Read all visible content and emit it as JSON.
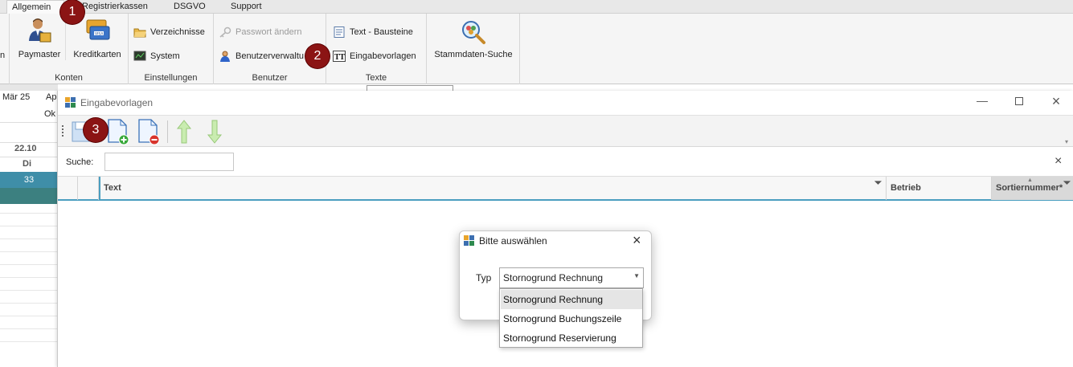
{
  "ribbon": {
    "tabs": [
      "Allgemein",
      "Registrierkassen",
      "DSGVO",
      "Support"
    ],
    "groups": {
      "konten": {
        "label": "Konten",
        "paymaster": "Paymaster",
        "kreditkarten": "Kreditkarten"
      },
      "einstellungen": {
        "label": "Einstellungen",
        "verzeichnisse": "Verzeichnisse",
        "system": "System"
      },
      "benutzer": {
        "label": "Benutzer",
        "passwort": "Passwort ändern",
        "benutzerverwaltung": "Benutzerverwaltu"
      },
      "texte": {
        "label": "Texte",
        "bausteine": "Text - Bausteine",
        "eingabevorlagen": "Eingabevorlagen"
      },
      "stammdaten": {
        "label": "Stammdaten-Suche"
      }
    },
    "left_edge_text": "n"
  },
  "background": {
    "month1": "Mär 25",
    "month2": "Ap",
    "ok_fragment": "Ok",
    "date": "22.10",
    "weekday": "Di",
    "count": "33"
  },
  "window": {
    "title": "Eingabevorlagen",
    "search_label": "Suche:",
    "search_value": "",
    "columns": [
      "Text",
      "Betrieb",
      "Sortiernummer*"
    ],
    "close_search": "×"
  },
  "dialog": {
    "title": "Bitte auswählen",
    "typ_label": "Typ",
    "selected": "Stornogrund Rechnung",
    "options": [
      "Stornogrund Rechnung",
      "Stornogrund Buchungszeile",
      "Stornogrund Reservierung"
    ]
  },
  "badges": [
    "1",
    "2",
    "3"
  ],
  "colors": {
    "badge": "#8b1414",
    "selected_row": "#3f8ea8",
    "teal_row": "#3c8080",
    "header_accent": "#4a9ec0"
  }
}
